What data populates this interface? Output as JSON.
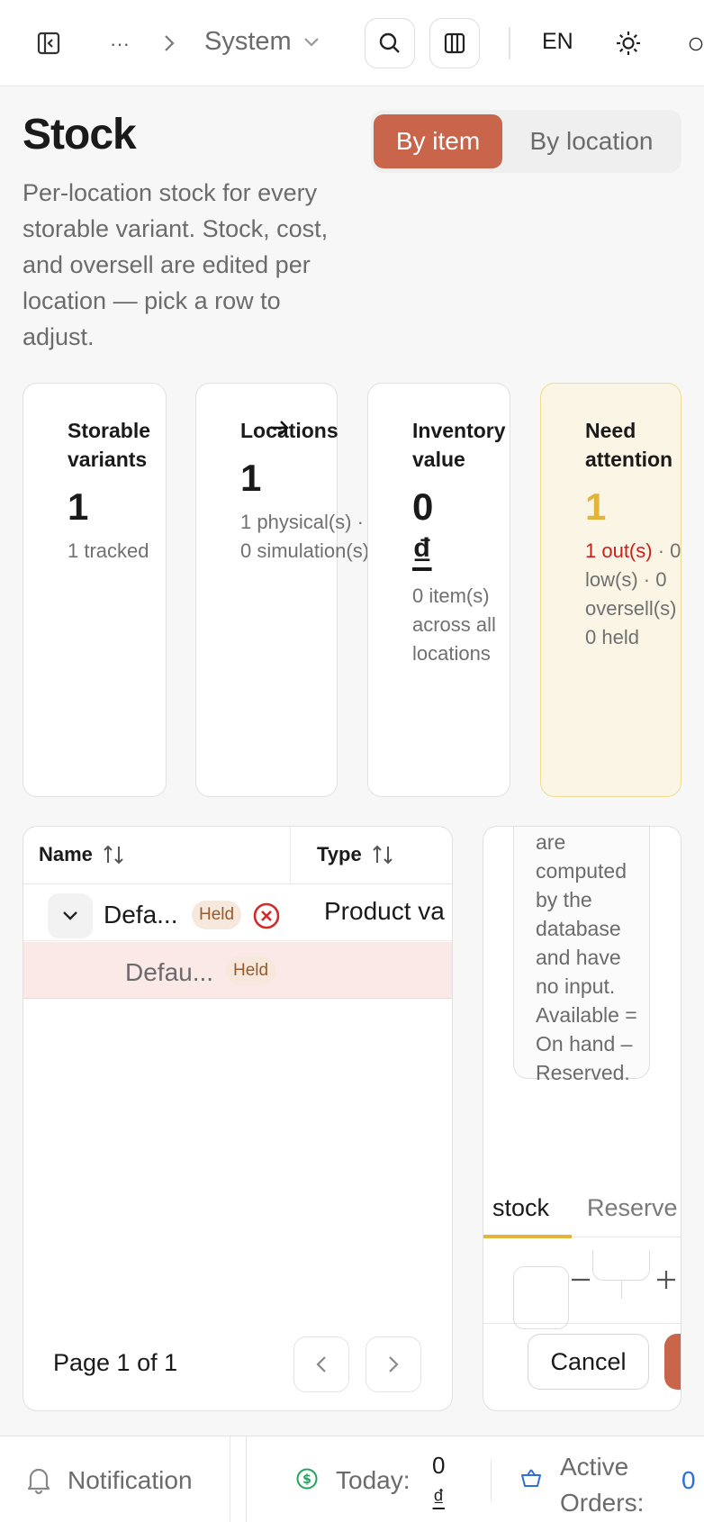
{
  "header": {
    "ellipsis": "···",
    "crumb_current": "System",
    "language": "EN"
  },
  "page": {
    "title": "Stock",
    "view_toggle": {
      "by_item": "By item",
      "by_location": "By location"
    },
    "description": "Per-location stock for every storable variant. Stock, cost, and oversell are edited per location — pick a row to adjust."
  },
  "stats": [
    {
      "label": "Storable variants",
      "value": "1",
      "sub": "1 tracked"
    },
    {
      "label": "Locations",
      "value": "1",
      "sub": "1 physical(s) · 0 simulation(s)"
    },
    {
      "label": "Inventory value",
      "value": "0",
      "currency": "₫",
      "sub": "0 item(s) across all locations"
    },
    {
      "label": "Need attention",
      "value": "1",
      "sub_alert": "1 out(s)",
      "sub": "· 0 low(s) · 0 oversell(s) · 0 held"
    }
  ],
  "table": {
    "columns": [
      "Name",
      "Type"
    ],
    "rows": [
      {
        "name": "Defa...",
        "badge": "Held",
        "type": "Product va"
      },
      {
        "name": "Defau...",
        "badge": "Held"
      }
    ],
    "pagination": "Page 1 of 1"
  },
  "panel": {
    "note": "are computed by the database and have no input. Available = On hand – Reserved.",
    "tabs": [
      "stock",
      "Reserve"
    ],
    "cancel": "Cancel"
  },
  "footer": {
    "notification": "Notification",
    "today_label": "Today:",
    "today_value": "0",
    "today_currency": "₫",
    "orders_label": "Active Orders:",
    "orders_value": "0"
  },
  "colors": {
    "accent": "#c8654a",
    "warning": "#e2b43a",
    "danger": "#cc1f1f",
    "success": "#22a55a",
    "link": "#2f6fd6"
  }
}
